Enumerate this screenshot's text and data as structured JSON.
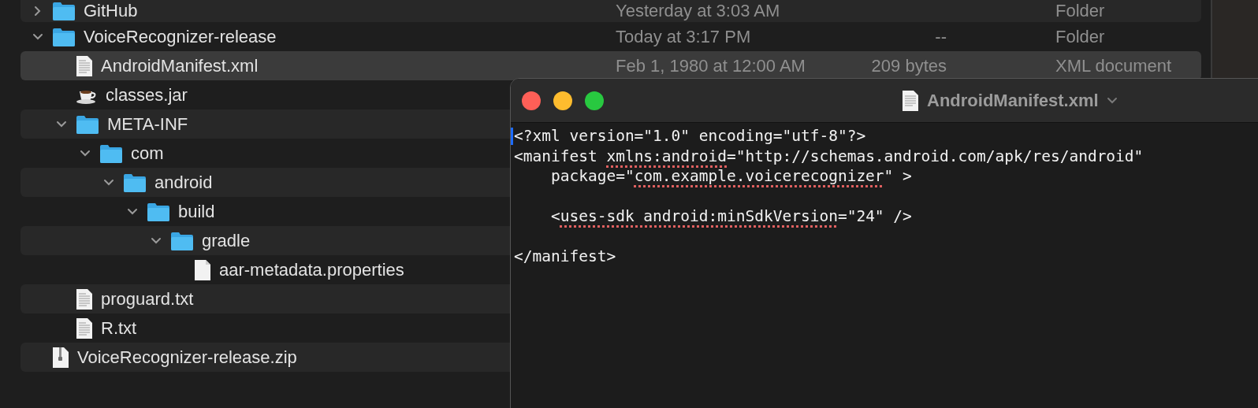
{
  "finder": {
    "items": [
      {
        "name": "GitHub",
        "kind": "folder",
        "date": "Yesterday at 3:03 AM",
        "kind_label": "Folder",
        "expanded": false,
        "selected": false
      },
      {
        "name": "VoiceRecognizer-release",
        "kind": "folder",
        "date": "Today at 3:17 PM",
        "size": "--",
        "kind_label": "Folder",
        "expanded": true,
        "selected": false,
        "children": [
          {
            "name": "AndroidManifest.xml",
            "kind": "text",
            "date": "Feb 1, 1980 at 12:00 AM",
            "size": "209 bytes",
            "kind_label": "XML document",
            "selected": true
          },
          {
            "name": "classes.jar",
            "kind": "jar",
            "selected": false
          },
          {
            "name": "META-INF",
            "kind": "folder",
            "expanded": true,
            "selected": false,
            "children": [
              {
                "name": "com",
                "kind": "folder",
                "expanded": true,
                "selected": false,
                "children": [
                  {
                    "name": "android",
                    "kind": "folder",
                    "expanded": true,
                    "selected": false,
                    "children": [
                      {
                        "name": "build",
                        "kind": "folder",
                        "expanded": true,
                        "selected": false,
                        "children": [
                          {
                            "name": "gradle",
                            "kind": "folder",
                            "expanded": true,
                            "selected": false,
                            "children": [
                              {
                                "name": "aar-metadata.properties",
                                "kind": "blank",
                                "selected": false
                              }
                            ]
                          }
                        ]
                      }
                    ]
                  }
                ]
              }
            ]
          },
          {
            "name": "proguard.txt",
            "kind": "text",
            "selected": false
          },
          {
            "name": "R.txt",
            "kind": "text",
            "selected": false
          }
        ]
      },
      {
        "name": "VoiceRecognizer-release.zip",
        "kind": "zip",
        "selected": false
      }
    ]
  },
  "editor": {
    "title": "AndroidManifest.xml",
    "lines": [
      {
        "space_before": false,
        "spans": [
          {
            "text": "<?xml version=\"1.0\" encoding=\"utf-8\"?>",
            "misspelled": false
          }
        ]
      },
      {
        "space_before": false,
        "spans": [
          {
            "text": "<manifest ",
            "misspelled": false
          },
          {
            "text": "xmlns:android",
            "misspelled": true
          },
          {
            "text": "=\"http://schemas.android.com/apk/res/android\"",
            "misspelled": false
          }
        ]
      },
      {
        "space_before": false,
        "spans": [
          {
            "text": "    package=\"",
            "misspelled": false
          },
          {
            "text": "com.example.voicerecognizer",
            "misspelled": true
          },
          {
            "text": "\" >",
            "misspelled": false
          }
        ]
      },
      {
        "space_before": true,
        "spans": [
          {
            "text": "    <",
            "misspelled": false
          },
          {
            "text": "uses-sdk android:minSdkVersion",
            "misspelled": true
          },
          {
            "text": "=\"24\" />",
            "misspelled": false
          }
        ]
      },
      {
        "space_before": true,
        "spans": [
          {
            "text": "</manifest>",
            "misspelled": false
          }
        ]
      }
    ]
  }
}
